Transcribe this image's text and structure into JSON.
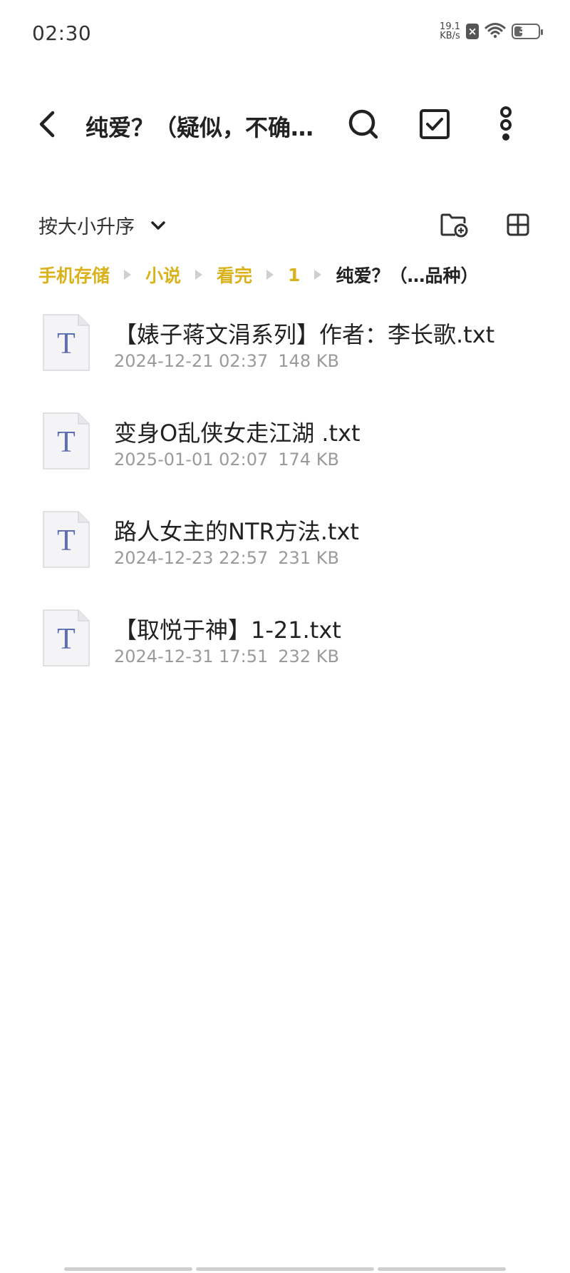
{
  "status_bar": {
    "time": "02:30",
    "net_speed_value": "19.1",
    "net_speed_unit": "KB/s",
    "battery": "33",
    "battery_level": 0.33
  },
  "app_bar": {
    "title": "纯爱？（疑似，不确…",
    "back_icon": "chevron-left-icon",
    "search_icon": "search-icon",
    "select_icon": "check-square-icon",
    "more_icon": "more-vertical-icon"
  },
  "toolbar": {
    "sort_label": "按大小升序",
    "new_folder_icon": "new-folder-icon",
    "view_icon": "grid-view-icon"
  },
  "breadcrumb": [
    "手机存储",
    "小说",
    "看完",
    "1",
    "纯爱？（…品种）"
  ],
  "files": [
    {
      "name": "【婊子蒋文涓系列】作者：李长歌.txt",
      "date": "2024-12-21 02:37",
      "size": "148 KB"
    },
    {
      "name": "变身O乱侠女走江湖 .txt",
      "date": "2025-01-01 02:07",
      "size": "174 KB"
    },
    {
      "name": "路人女主的NTR方法.txt",
      "date": "2024-12-23 22:57",
      "size": "231 KB"
    },
    {
      "name": "【取悦于神】1-21.txt",
      "date": "2024-12-31 17:51",
      "size": "232 KB"
    }
  ],
  "file_icon_letter": "T",
  "colors": {
    "accent": "#d9b21c",
    "file_icon_letter": "#5b6db4",
    "meta_text": "#9a9a9a"
  }
}
